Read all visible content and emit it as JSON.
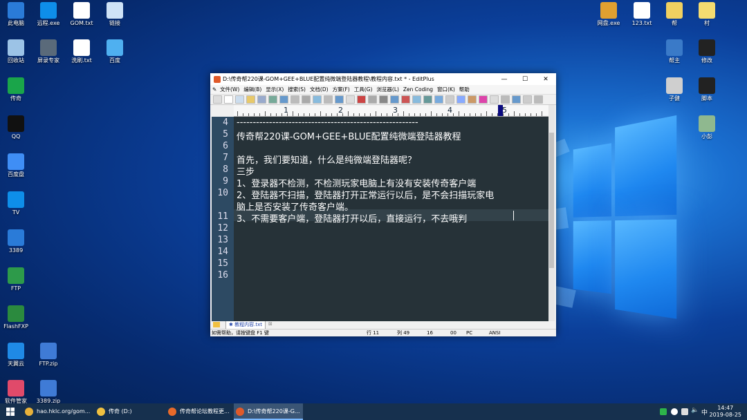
{
  "desktop": {
    "left_icons": [
      {
        "label": "此电脑",
        "icon": "computer-icon",
        "color": "#2a7bd8"
      },
      {
        "label": "远程.exe",
        "icon": "teamviewer-icon",
        "color": "#0e8ee9"
      },
      {
        "label": "GOM.txt",
        "icon": "text-file-icon",
        "color": "#ffffff"
      },
      {
        "label": "链接",
        "icon": "link-icon",
        "color": "#cfe3f7"
      },
      {
        "label": "回收站",
        "icon": "recycle-bin-icon",
        "color": "#9cc3e6"
      },
      {
        "label": "屏录专家",
        "icon": "screen-recorder-icon",
        "color": "#5a6a7a"
      },
      {
        "label": "洗刷.txt",
        "icon": "text-file-icon",
        "color": "#ffffff"
      },
      {
        "label": "百度",
        "icon": "baidu-cloud-icon",
        "color": "#4fb0f0"
      },
      {
        "label": "传奇",
        "icon": "shield-icon",
        "color": "#1aa54a"
      },
      {
        "label": "QQ",
        "icon": "qq-icon",
        "color": "#111111"
      },
      {
        "label": "百度盘",
        "icon": "baidu-pan-icon",
        "color": "#3f8ef5"
      },
      {
        "label": "TV",
        "icon": "tv-icon",
        "color": "#0e8ee9"
      },
      {
        "label": "3389",
        "icon": "remote-desktop-icon",
        "color": "#2a7bd8"
      },
      {
        "label": "FTP",
        "icon": "ftp-icon",
        "color": "#2d9a4a"
      },
      {
        "label": "FlashFXP",
        "icon": "flashfxp-icon",
        "color": "#2b8a3e"
      },
      {
        "label": "天翼云",
        "icon": "cloud-icon",
        "color": "#1f8ae6"
      },
      {
        "label": "FTP.zip",
        "icon": "archive-icon",
        "color": "#3f7bd6"
      },
      {
        "label": "软件管家",
        "icon": "app-manager-icon",
        "color": "#e04a6a"
      },
      {
        "label": "3389.zip",
        "icon": "archive-icon",
        "color": "#3f7bd6"
      }
    ],
    "right_icons": [
      {
        "label": "网盘.exe",
        "icon": "netdisk-icon",
        "color": "#e0a030"
      },
      {
        "label": "123.txt",
        "icon": "text-file-icon",
        "color": "#ffffff"
      },
      {
        "label": "帮",
        "icon": "document-icon",
        "color": "#f0d060"
      },
      {
        "label": "村",
        "icon": "document-icon",
        "color": "#f5dc70"
      },
      {
        "label": "帮主",
        "icon": "logo-icon",
        "color": "#3a7ac8"
      },
      {
        "label": "修改",
        "icon": "game-icon",
        "color": "#222222"
      },
      {
        "label": "子健",
        "icon": "avatar-icon",
        "color": "#cfcfcf"
      },
      {
        "label": "脚本",
        "icon": "game-icon",
        "color": "#222222"
      },
      {
        "label": "小彭",
        "icon": "avatar-icon",
        "color": "#8fb88f"
      }
    ]
  },
  "window": {
    "title": "D:\\传奇帮220课-GOM+GEE+BLUE配置纯微端登陆器教程\\教程内容.txt * - EditPlus",
    "menu": [
      "文件(W)",
      "编辑(B)",
      "显示(X)",
      "搜索(S)",
      "文档(D)",
      "方案(F)",
      "工具(G)",
      "浏览器(L)",
      "Zen Coding",
      "窗口(K)",
      "帮助"
    ],
    "ruler_numbers": [
      "1",
      "2",
      "3",
      "4",
      "5"
    ],
    "line_numbers": [
      "4",
      "5",
      "6",
      "7",
      "8",
      "9",
      "10",
      "",
      "11",
      "12",
      "13",
      "14",
      "15",
      "16"
    ],
    "lines": [
      "--------------------------------------------------------",
      "传奇帮220课-GOM+GEE+BLUE配置纯微端登陆器教程",
      "",
      "首先，我们要知道，什么是纯微端登陆器呢？",
      "三步",
      "1、登录器不检测，不检测玩家电脑上有没有安装传奇客户端",
      "2、登陆器不扫描，登陆器打开正常运行以后，是不会扫描玩家电",
      "脑上是否安装了传奇客户端。",
      "3、不需要客户端，登陆器打开以后，直接运行，不去哦判"
    ],
    "tab_label": "教程内容.txt",
    "status": {
      "help": "如需帮助，请按键盘 F1 键",
      "line": "行 11",
      "col": "列 49",
      "sel": "16",
      "code": "00",
      "mode": "PC",
      "encoding": "ANSI"
    }
  },
  "taskbar": {
    "items": [
      {
        "label": "hao.hklc.org/gom...",
        "icon": "chrome-icon",
        "color": "#e8b13a"
      },
      {
        "label": "传奇 (D:)",
        "icon": "folder-icon",
        "color": "#f0c040"
      },
      {
        "label": "传奇帮论坛教程更...",
        "icon": "firefox-icon",
        "color": "#e86a2a"
      },
      {
        "label": "D:\\传奇帮220课-G...",
        "icon": "editplus-icon",
        "color": "#e05a2a"
      }
    ],
    "ime": "中",
    "time": "14:47",
    "date": "2019-08-25"
  }
}
